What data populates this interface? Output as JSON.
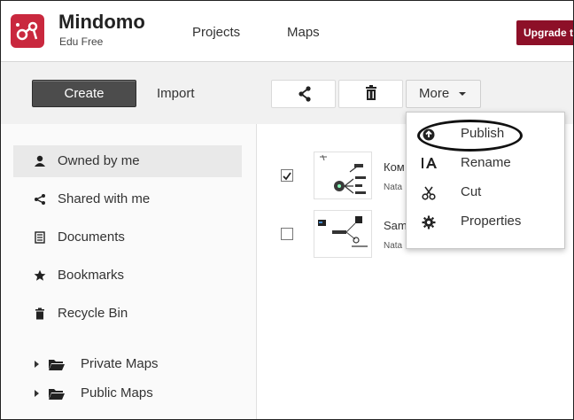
{
  "header": {
    "brand_name": "Mindomo",
    "brand_plan": "Edu Free",
    "nav": [
      "Projects",
      "Maps"
    ],
    "upgrade_label": "Upgrade t"
  },
  "toolbar": {
    "create_label": "Create",
    "import_label": "Import",
    "share_icon": "share-icon",
    "delete_icon": "trash-icon",
    "more_label": "More"
  },
  "sidebar": {
    "items": [
      {
        "label": "Owned by me",
        "icon": "user-icon",
        "active": true
      },
      {
        "label": "Shared with me",
        "icon": "share-icon"
      },
      {
        "label": "Documents",
        "icon": "document-icon"
      },
      {
        "label": "Bookmarks",
        "icon": "star-icon"
      },
      {
        "label": "Recycle Bin",
        "icon": "trash-icon"
      }
    ],
    "folders": [
      {
        "label": "Private Maps",
        "icon": "folder-icon"
      },
      {
        "label": "Public Maps",
        "icon": "folder-icon"
      }
    ]
  },
  "maps": [
    {
      "title": "Ком",
      "owner": "Nata",
      "checked": true
    },
    {
      "title": "Sam",
      "owner": "Nata",
      "checked": false
    }
  ],
  "more_menu": {
    "items": [
      {
        "label": "Publish",
        "icon": "publish-icon"
      },
      {
        "label": "Rename",
        "icon": "rename-icon"
      },
      {
        "label": "Cut",
        "icon": "scissors-icon"
      },
      {
        "label": "Properties",
        "icon": "gear-icon"
      }
    ]
  },
  "colors": {
    "brand": "#c9283e",
    "upgrade": "#8d1028",
    "create_button": "#4c4c4c"
  }
}
